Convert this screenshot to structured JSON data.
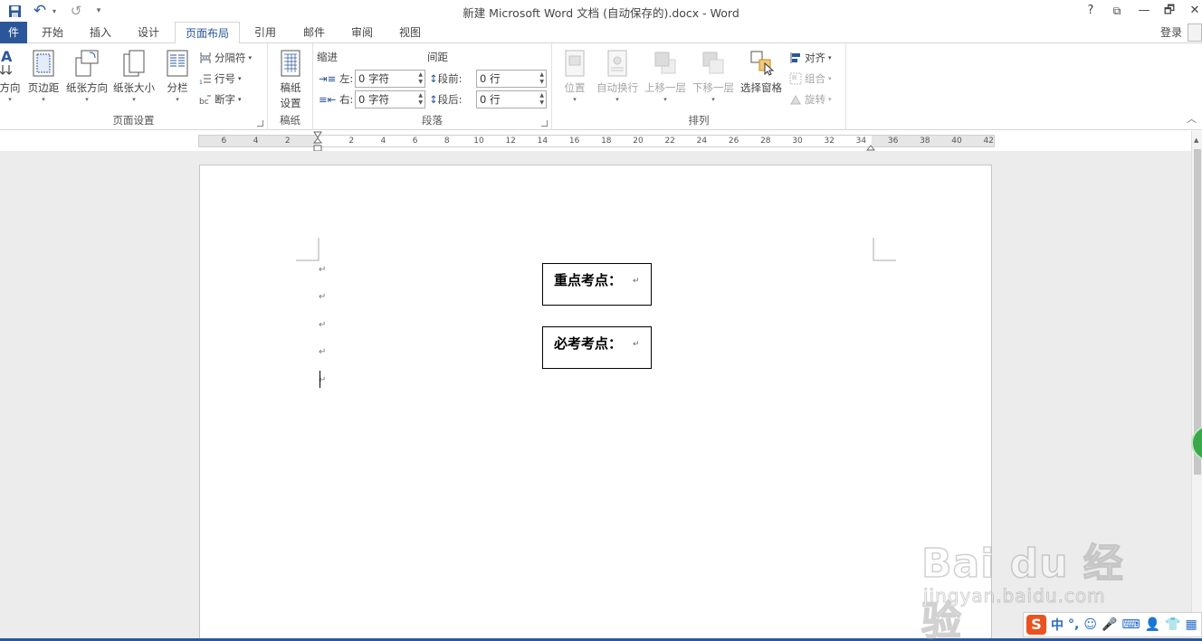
{
  "titlebar": {
    "title": "新建 Microsoft Word 文档 (自动保存的).docx - Word",
    "help": "?",
    "restore_ribbon": "⧉",
    "minimize": "—",
    "maximize": "🗗",
    "close": "✕",
    "undo": "↶",
    "redo": "↺",
    "customize": "▾"
  },
  "tabs": {
    "file": "件",
    "home": "开始",
    "insert": "插入",
    "design": "设计",
    "layout": "页面布局",
    "references": "引用",
    "mailings": "邮件",
    "review": "审阅",
    "view": "视图",
    "login": "登录"
  },
  "ribbon": {
    "page_setup": {
      "label": "页面设置",
      "text_direction": "方向",
      "margins": "页边距",
      "orientation": "纸张方向",
      "size": "纸张大小",
      "columns": "分栏",
      "breaks": "分隔符",
      "line_numbers": "行号",
      "hyphenation": "断字"
    },
    "manuscript": {
      "label": "稿纸",
      "button_line1": "稿纸",
      "button_line2": "设置"
    },
    "paragraph": {
      "label": "段落",
      "indent_title": "缩进",
      "spacing_title": "间距",
      "indent_left_label": "左:",
      "indent_left_value": "0 字符",
      "indent_right_label": "右:",
      "indent_right_value": "0 字符",
      "spacing_before_label": "段前:",
      "spacing_before_value": "0 行",
      "spacing_after_label": "段后:",
      "spacing_after_value": "0 行"
    },
    "arrange": {
      "label": "排列",
      "position": "位置",
      "wrap_text": "自动换行",
      "bring_forward": "上移一层",
      "send_backward": "下移一层",
      "selection_pane": "选择窗格",
      "align": "对齐",
      "group": "组合",
      "rotate": "旋转"
    }
  },
  "ruler": {
    "left_labels": [
      "6",
      "4",
      "2"
    ],
    "right_labels": [
      "2",
      "4",
      "6",
      "8",
      "10",
      "12",
      "14",
      "16",
      "18",
      "20",
      "22",
      "24",
      "26",
      "28",
      "30",
      "32",
      "34",
      "36",
      "38",
      "40",
      "42"
    ]
  },
  "document": {
    "paragraph_mark": "↵",
    "textbox1": "重点考点：",
    "textbox2": "必考考点："
  },
  "watermark": {
    "logo": "Bai du 经验",
    "url": "jingyan.baidu.com"
  },
  "ime": {
    "logo": "S",
    "chinese": "中",
    "punct": "°,",
    "emoji": "☺",
    "voice": "🎤",
    "keyboard": "⌨",
    "user": "👤",
    "skin": "👕",
    "tools": "▦"
  },
  "colors": {
    "accent": "#2b579a",
    "ime_logo": "#e8531f",
    "float_ball": "#3aa84b"
  }
}
